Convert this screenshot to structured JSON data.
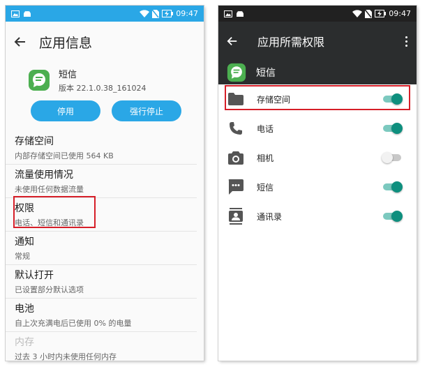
{
  "status_bar": {
    "time": "09:47"
  },
  "left": {
    "title": "应用信息",
    "app": {
      "name": "短信",
      "version": "版本 22.1.0.38_161024"
    },
    "buttons": {
      "disable": "停用",
      "force_stop": "强行停止"
    },
    "items": [
      {
        "title": "存储空间",
        "subtitle": "内部存储空间已使用 564 KB"
      },
      {
        "title": "流量使用情况",
        "subtitle": "未使用任何数据流量"
      },
      {
        "title": "权限",
        "subtitle": "电话、短信和通讯录"
      },
      {
        "title": "通知",
        "subtitle": "常规"
      },
      {
        "title": "默认打开",
        "subtitle": "已设置部分默认选项"
      },
      {
        "title": "电池",
        "subtitle": "自上次充满电后已使用 0% 的电量"
      },
      {
        "title": "内存",
        "subtitle": "过去 3 小时内未使用任何内存"
      }
    ]
  },
  "right": {
    "title": "应用所需权限",
    "app_name": "短信",
    "permissions": [
      {
        "label": "存储空间",
        "icon": "folder-icon",
        "enabled": true
      },
      {
        "label": "电话",
        "icon": "phone-icon",
        "enabled": true
      },
      {
        "label": "相机",
        "icon": "camera-icon",
        "enabled": false
      },
      {
        "label": "短信",
        "icon": "sms-icon",
        "enabled": true
      },
      {
        "label": "通讯录",
        "icon": "contacts-icon",
        "enabled": true
      }
    ]
  },
  "colors": {
    "accent": "#2aa7e6",
    "toggle_on": "#0e8f7e",
    "highlight": "#d61e28",
    "app_icon": "#4caf50"
  }
}
